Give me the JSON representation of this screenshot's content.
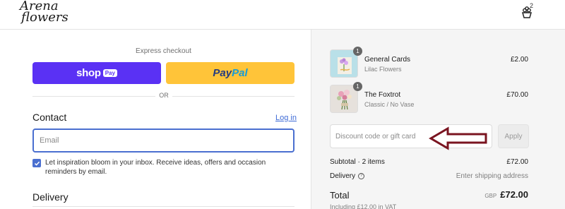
{
  "header": {
    "logo_line1": "Arena",
    "logo_line2": "flowers",
    "cart_count": "2"
  },
  "express": {
    "label": "Express checkout",
    "shop_label": "shop",
    "shop_pay_badge": "Pay",
    "paypal_part1": "Pay",
    "paypal_part2": "Pal",
    "divider": "OR"
  },
  "contact": {
    "heading": "Contact",
    "login_link": "Log in",
    "email_placeholder": "Email",
    "email_value": "",
    "marketing_checked": true,
    "marketing_label": "Let inspiration bloom in your inbox. Receive ideas, offers and occasion reminders by email."
  },
  "delivery": {
    "heading": "Delivery"
  },
  "order": {
    "items": [
      {
        "name": "General Cards",
        "variant": "Lilac Flowers",
        "price": "£2.00",
        "qty": "1"
      },
      {
        "name": "The Foxtrot",
        "variant": "Classic / No Vase",
        "price": "£70.00",
        "qty": "1"
      }
    ],
    "discount_placeholder": "Discount code or gift card",
    "apply_label": "Apply",
    "subtotal_label": "Subtotal · 2 items",
    "subtotal_value": "£72.00",
    "delivery_label": "Delivery",
    "delivery_value": "Enter shipping address",
    "total_label": "Total",
    "total_currency": "GBP",
    "total_value": "£72.00",
    "vat_note": "Including £12.00 in VAT"
  },
  "colors": {
    "shop_purple": "#5a31f4",
    "paypal_yellow": "#ffc439",
    "accent_blue": "#4a6fd0",
    "annotation_arrow": "#7a1420"
  },
  "icons": {
    "cart": "flower-bag-icon",
    "checkbox": "checkmark-icon",
    "info": "info-icon",
    "annotation": "arrow-left-icon"
  }
}
